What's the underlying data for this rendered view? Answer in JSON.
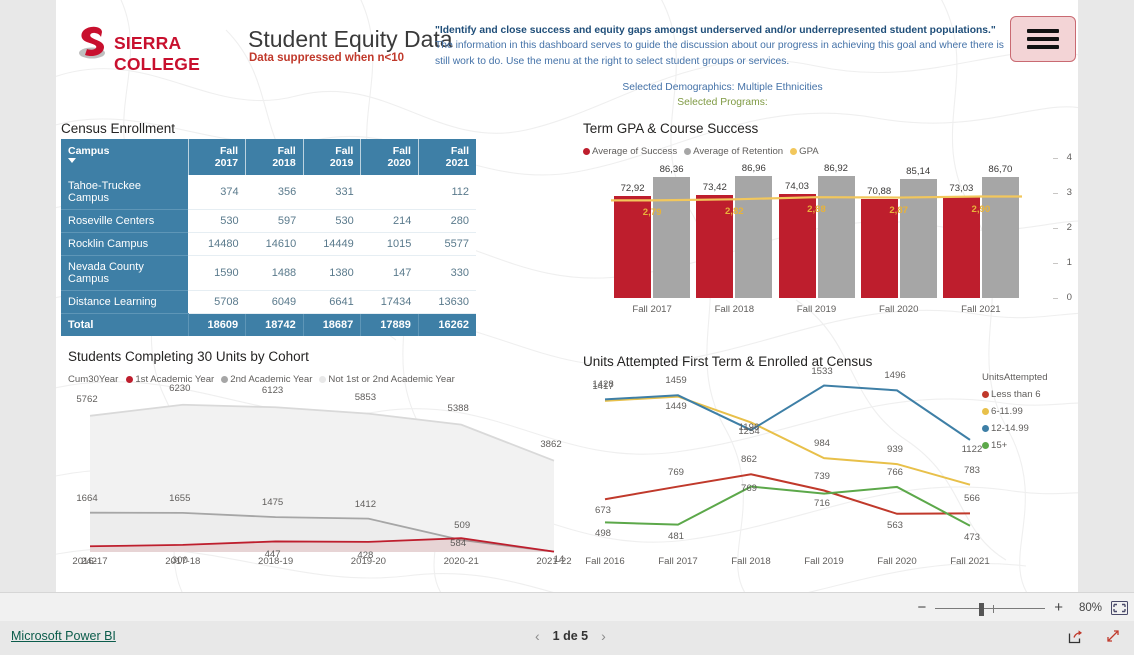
{
  "header": {
    "logo_text": "SIERRA COLLEGE",
    "title": "Student Equity Data",
    "subtitle": "Data suppressed when n<10",
    "quote": "\"Identify and close success and equity gaps amongst underserved and/or underrepresented student populations.\"",
    "body": "The information in this dashboard serves to guide the discussion about our progress in achieving this goal and where there is still work to do.  Use the menu at the right to select student groups or services.",
    "selected_demographics": "Selected Demographics: Multiple Ethnicities",
    "selected_programs": "Selected Programs:",
    "menu_label": "Menu"
  },
  "census": {
    "title": "Census Enrollment",
    "columns": [
      "Campus",
      "Fall 2017",
      "Fall 2018",
      "Fall 2019",
      "Fall 2020",
      "Fall 2021"
    ],
    "rows": [
      {
        "label": "Tahoe-Truckee Campus",
        "values": [
          "374",
          "356",
          "331",
          "",
          "112"
        ]
      },
      {
        "label": "Roseville Centers",
        "values": [
          "530",
          "597",
          "530",
          "214",
          "280"
        ]
      },
      {
        "label": "Rocklin Campus",
        "values": [
          "14480",
          "14610",
          "14449",
          "1015",
          "5577"
        ]
      },
      {
        "label": "Nevada County Campus",
        "values": [
          "1590",
          "1488",
          "1380",
          "147",
          "330"
        ]
      },
      {
        "label": "Distance Learning",
        "values": [
          "5708",
          "6049",
          "6641",
          "17434",
          "13630"
        ]
      }
    ],
    "total": {
      "label": "Total",
      "values": [
        "18609",
        "18742",
        "18687",
        "17889",
        "16262"
      ]
    }
  },
  "chart_data": [
    {
      "id": "gpa",
      "type": "bar",
      "title": "Term GPA & Course Success",
      "categories": [
        "Fall 2017",
        "Fall 2018",
        "Fall 2019",
        "Fall 2020",
        "Fall 2021"
      ],
      "legend": [
        {
          "name": "Average of Success",
          "color": "#BE1E2D"
        },
        {
          "name": "Average of Retention",
          "color": "#A6A6A6"
        },
        {
          "name": "GPA",
          "color": "#F2C75C"
        }
      ],
      "series": [
        {
          "name": "Average of Success",
          "labels": [
            "72,92",
            "73,42",
            "74,03",
            "70,88",
            "73,03"
          ],
          "values": [
            72.92,
            73.42,
            74.03,
            70.88,
            73.03
          ]
        },
        {
          "name": "Average of Retention",
          "labels": [
            "86,36",
            "86,96",
            "86,92",
            "85,14",
            "86,70"
          ],
          "values": [
            86.36,
            86.96,
            86.92,
            85.14,
            86.7
          ]
        },
        {
          "name": "GPA",
          "labels": [
            "2,79",
            "2,82",
            "2,88",
            "2,87",
            "2,90"
          ],
          "values": [
            2.79,
            2.82,
            2.88,
            2.87,
            2.9
          ]
        }
      ],
      "y2_ticks": [
        "4",
        "3",
        "2",
        "1",
        "0"
      ],
      "ylim": [
        0,
        100
      ],
      "y2lim": [
        0,
        4
      ],
      "grid": false,
      "legend_position": "top"
    },
    {
      "id": "cohort",
      "type": "area",
      "title": "Students Completing 30 Units by Cohort",
      "legend_title": "Cum30Year",
      "categories": [
        "2016-17",
        "2017-18",
        "2018-19",
        "2019-20",
        "2020-21",
        "2021-22"
      ],
      "legend": [
        {
          "name": "1st Academic Year",
          "color": "#BE1E2D"
        },
        {
          "name": "2nd Academic Year",
          "color": "#A6A6A6"
        },
        {
          "name": "Not 1st or 2nd Academic Year",
          "color": "#E8E8E8"
        }
      ],
      "series": [
        {
          "name": "1st Academic Year",
          "values": [
            242,
            300,
            447,
            428,
            584,
            14
          ],
          "labels": [
            "242",
            "300",
            "447",
            "428",
            "584",
            "14"
          ]
        },
        {
          "name": "2nd Academic Year",
          "values": [
            1664,
            1655,
            1475,
            1412,
            509,
            14
          ],
          "labels": [
            "1664",
            "1655",
            "1475",
            "1412",
            "509",
            ""
          ]
        },
        {
          "name": "Not 1st or 2nd Academic Year",
          "values": [
            5762,
            6230,
            6123,
            5853,
            5388,
            3862
          ],
          "labels": [
            "5762",
            "6230",
            "6123",
            "5853",
            "5388",
            "3862"
          ]
        }
      ],
      "ylim": [
        0,
        7000
      ],
      "grid": false,
      "legend_position": "top"
    },
    {
      "id": "units",
      "type": "line",
      "title": "Units Attempted First Term & Enrolled at Census",
      "legend_title": "UnitsAttempted",
      "categories": [
        "Fall 2016",
        "Fall 2017",
        "Fall 2018",
        "Fall 2019",
        "Fall 2020",
        "Fall 2021"
      ],
      "legend": [
        {
          "name": "Less than 6",
          "color": "#C0392B"
        },
        {
          "name": "6-11.99",
          "color": "#E8C04A"
        },
        {
          "name": "12-14.99",
          "color": "#3E7FA6"
        },
        {
          "name": "15+",
          "color": "#5CA84A"
        }
      ],
      "series": [
        {
          "name": "Less than 6",
          "values": [
            673,
            769,
            862,
            739,
            563,
            566
          ],
          "labels": [
            "673",
            "769",
            "862",
            "739",
            "563",
            "566"
          ]
        },
        {
          "name": "6-11.99",
          "values": [
            1417,
            1449,
            1254,
            984,
            939,
            783
          ],
          "labels": [
            "1417",
            "1449",
            "1254",
            "984",
            "939",
            "783"
          ]
        },
        {
          "name": "12-14.99",
          "values": [
            1428,
            1459,
            1196,
            1533,
            1496,
            1122
          ],
          "labels": [
            "1428",
            "1459",
            "1196",
            "1533",
            "1496",
            "1122"
          ]
        },
        {
          "name": "15+",
          "values": [
            498,
            481,
            769,
            716,
            766,
            473
          ],
          "labels": [
            "498",
            "481",
            "769",
            "716",
            "766",
            "473"
          ]
        }
      ],
      "ylim": [
        400,
        1600
      ],
      "grid": false,
      "legend_position": "right"
    }
  ],
  "zoombar": {
    "minus": "−",
    "plus": "+",
    "zoom_level": "80%",
    "fit_label": "Fit to page"
  },
  "statusbar": {
    "brand": "Microsoft Power BI",
    "prev": "‹",
    "next": "›",
    "page_text": "1 de 5",
    "share_label": "Share",
    "fullscreen_label": "Full screen"
  }
}
